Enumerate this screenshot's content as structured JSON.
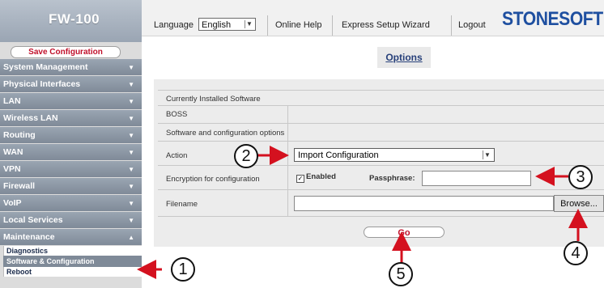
{
  "app": {
    "product": "FW-100",
    "logo_text": "STONESOFT"
  },
  "sidebar": {
    "save_label": "Save Configuration",
    "items": [
      {
        "label": "System Management"
      },
      {
        "label": "Physical Interfaces"
      },
      {
        "label": "LAN"
      },
      {
        "label": "Wireless LAN"
      },
      {
        "label": "Routing"
      },
      {
        "label": "WAN"
      },
      {
        "label": "VPN"
      },
      {
        "label": "Firewall"
      },
      {
        "label": "VoIP"
      },
      {
        "label": "Local Services"
      },
      {
        "label": "Maintenance"
      }
    ],
    "sub_items": [
      {
        "label": "Diagnostics"
      },
      {
        "label": "Software & Configuration"
      },
      {
        "label": "Reboot"
      }
    ]
  },
  "topbar": {
    "language_label": "Language",
    "language_value": "English",
    "online_help": "Online Help",
    "express_setup": "Express Setup Wizard",
    "logout": "Logout"
  },
  "main": {
    "tab_title": "Options",
    "section_installed": "Currently Installed Software",
    "boss_label": "BOSS",
    "section_options": "Software and configuration options",
    "action_label": "Action",
    "action_value": "Import Configuration",
    "encryption_label": "Encryption for configuration",
    "enabled_label": "Enabled",
    "passphrase_label": "Passphrase:",
    "filename_label": "Filename",
    "browse_label": "Browse...",
    "go_label": "Go"
  },
  "callouts": [
    "1",
    "2",
    "3",
    "4",
    "5"
  ],
  "colors": {
    "accent_red": "#c0102a",
    "logo_blue": "#1e4fa0",
    "nav_gray": "#8a95a3"
  }
}
